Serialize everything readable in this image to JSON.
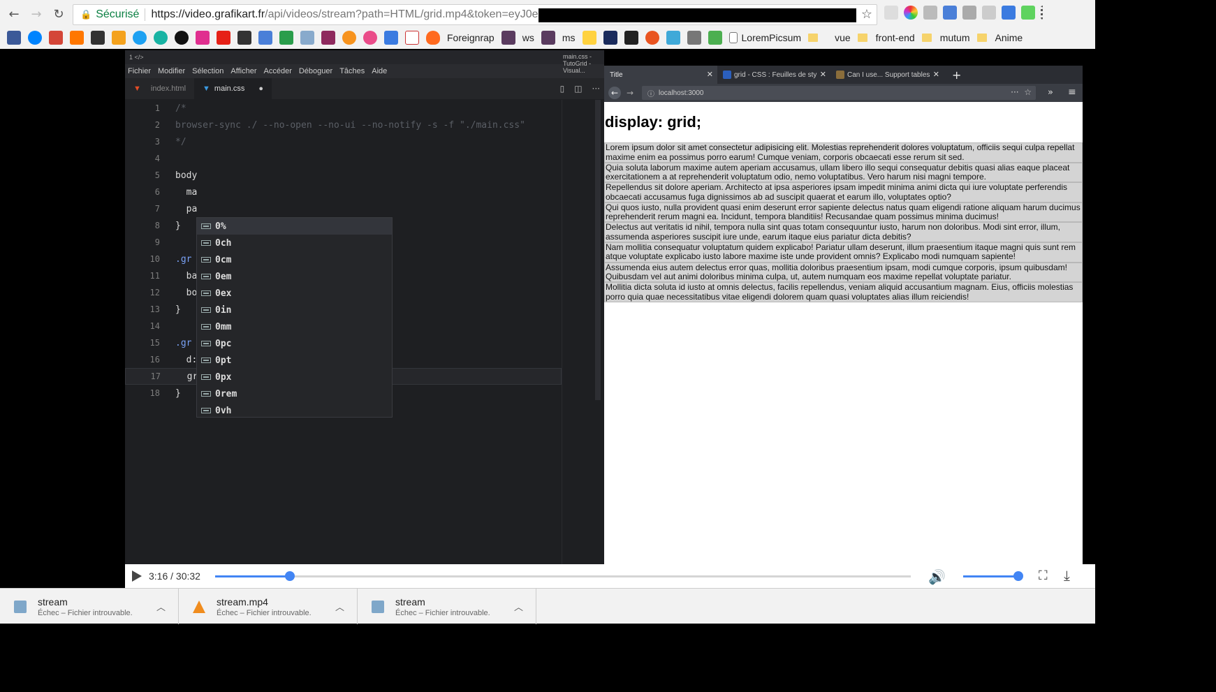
{
  "chrome": {
    "secure_label": "Sécurisé",
    "url_host": "https://video.grafikart.fr",
    "url_path": "/api/videos/stream?path=HTML/grid.mp4&token=eyJ0e",
    "bookmarks": [
      "Foreignrap",
      "ws",
      "ms",
      "LoremPicsum",
      "vue",
      "front-end",
      "mutum",
      "Anime"
    ]
  },
  "vscode": {
    "titlebar_left": "1 </>",
    "window_title": "main.css - TutoGrid - Visual...",
    "menu": [
      "Fichier",
      "Modifier",
      "Sélection",
      "Afficher",
      "Accéder",
      "Déboguer",
      "Tâches",
      "Aide"
    ],
    "tabs": [
      {
        "label": "index.html"
      },
      {
        "label": "main.css"
      }
    ],
    "lines": [
      {
        "n": "1",
        "text": "/*"
      },
      {
        "n": "2",
        "text": "browser-sync ./ --no-open --no-ui --no-notify -s -f \"./main.css\""
      },
      {
        "n": "3",
        "text": "*/"
      },
      {
        "n": "4",
        "text": ""
      },
      {
        "n": "5",
        "text": "body"
      },
      {
        "n": "6",
        "text": "  ma"
      },
      {
        "n": "7",
        "text": "  pa"
      },
      {
        "n": "8",
        "text": "}"
      },
      {
        "n": "9",
        "text": ""
      },
      {
        "n": "10",
        "text": ".gr"
      },
      {
        "n": "11",
        "text": "  ba"
      },
      {
        "n": "12",
        "text": "  bo"
      },
      {
        "n": "13",
        "text": "}"
      },
      {
        "n": "14",
        "text": ""
      },
      {
        "n": "15",
        "text": ".gr"
      },
      {
        "n": "16",
        "text": "  d:"
      },
      {
        "n": "17",
        "text": "  grid-template-columns:"
      },
      {
        "n": "18",
        "text": "}"
      }
    ],
    "suggestions": [
      "0%",
      "0ch",
      "0cm",
      "0em",
      "0ex",
      "0in",
      "0mm",
      "0pc",
      "0pt",
      "0px",
      "0rem",
      "0vh"
    ]
  },
  "browser": {
    "tabs": [
      "Title",
      "grid - CSS : Feuilles de sty",
      "Can I use... Support tables"
    ],
    "url": "localhost:3000",
    "heading": "display: grid;",
    "items": [
      "Lorem ipsum dolor sit amet consectetur adipisicing elit. Molestias reprehenderit dolores voluptatum, officiis sequi culpa repellat maxime enim ea possimus porro earum! Cumque veniam, corporis obcaecati esse rerum sit sed.",
      "Quia soluta laborum maxime autem aperiam accusamus, ullam libero illo sequi consequatur debitis quasi alias eaque placeat exercitationem a at reprehenderit voluptatum odio, nemo voluptatibus. Vero harum nisi magni tempore.",
      "Repellendus sit dolore aperiam. Architecto at ipsa asperiores ipsam impedit minima animi dicta qui iure voluptate perferendis obcaecati accusamus fuga dignissimos ab ad suscipit quaerat et earum illo, voluptates optio?",
      "Qui quos iusto, nulla provident quasi enim deserunt error sapiente delectus natus quam eligendi ratione aliquam harum ducimus reprehenderit rerum magni ea. Incidunt, tempora blanditiis! Recusandae quam possimus minima ducimus!",
      "Delectus aut veritatis id nihil, tempora nulla sint quas totam consequuntur iusto, harum non doloribus. Modi sint error, illum, assumenda asperiores suscipit iure unde, earum itaque eius pariatur dicta debitis?",
      "Nam mollitia consequatur voluptatum quidem explicabo! Pariatur ullam deserunt, illum praesentium itaque magni quis sunt rem atque voluptate explicabo iusto labore maxime iste unde provident omnis? Explicabo modi numquam sapiente!",
      "Assumenda eius autem delectus error quas, mollitia doloribus praesentium ipsam, modi cumque corporis, ipsum quibusdam! Quibusdam vel aut animi doloribus minima culpa, ut, autem numquam eos maxime repellat voluptate pariatur.",
      "Mollitia dicta soluta id iusto at omnis delectus, facilis repellendus, veniam aliquid accusantium magnam. Eius, officiis molestias porro quia quae necessitatibus vitae eligendi dolorem quam quasi voluptates alias illum reiciendis!"
    ]
  },
  "player": {
    "time": "3:16 / 30:32",
    "progress_fraction": 0.107,
    "volume_fraction": 1.0
  },
  "downloads": [
    {
      "name": "stream",
      "status": "Échec – Fichier introuvable."
    },
    {
      "name": "stream.mp4",
      "status": "Échec – Fichier introuvable."
    },
    {
      "name": "stream",
      "status": "Échec – Fichier introuvable."
    }
  ],
  "colors": {
    "accent": "#4285f4",
    "secure": "#0b8043",
    "editor_bg": "#1e1f22"
  }
}
